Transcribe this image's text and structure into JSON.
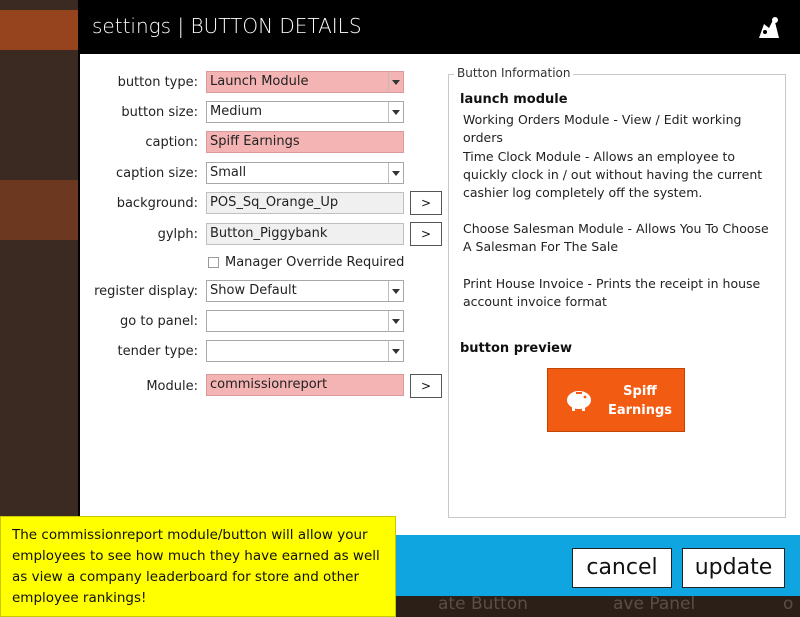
{
  "dialog": {
    "title": "settings | BUTTON DETAILS"
  },
  "form": {
    "button_type": {
      "label": "button type:",
      "value": "Launch Module"
    },
    "button_size": {
      "label": "button size:",
      "value": "Medium"
    },
    "caption": {
      "label": "caption:",
      "value": "Spiff Earnings"
    },
    "caption_size": {
      "label": "caption size:",
      "value": "Small"
    },
    "background": {
      "label": "background:",
      "value": "POS_Sq_Orange_Up",
      "browse": ">"
    },
    "glyph": {
      "label": "gylph:",
      "value": "Button_Piggybank",
      "browse": ">"
    },
    "manager_override": {
      "label": "Manager Override Required",
      "checked": false
    },
    "register_display": {
      "label": "register display:",
      "value": "Show Default"
    },
    "go_to_panel": {
      "label": "go to panel:",
      "value": ""
    },
    "tender_type": {
      "label": "tender type:",
      "value": ""
    },
    "module": {
      "label": "Module:",
      "value": "commissionreport",
      "browse": ">"
    }
  },
  "info": {
    "group_title": "Button Information",
    "heading": "launch module",
    "lines": [
      "Working Orders Module - View / Edit working orders",
      "Time Clock Module - Allows an employee to quickly clock in / out without having the current cashier log completely off the system.",
      "Choose Salesman Module - Allows You To Choose A Salesman For The Sale",
      "Print House Invoice - Prints the receipt in house account invoice format"
    ],
    "preview_heading": "button preview",
    "preview_caption": "Spiff Earnings"
  },
  "footer": {
    "cancel_label": "cancel",
    "update_label": "update"
  },
  "note": {
    "text": "The commissionreport module/button will allow your employees to see how much they have earned as well as view a company leaderboard for store and other employee rankings!"
  },
  "background_app": {
    "fragments": [
      "ate Button",
      "ave Panel",
      "o"
    ]
  },
  "colors": {
    "required_field": "#f4b4b4",
    "accent_bar": "#0ea5e0",
    "preview_button": "#f25c12",
    "note": "#ffff00",
    "titlebar": "#000000"
  }
}
